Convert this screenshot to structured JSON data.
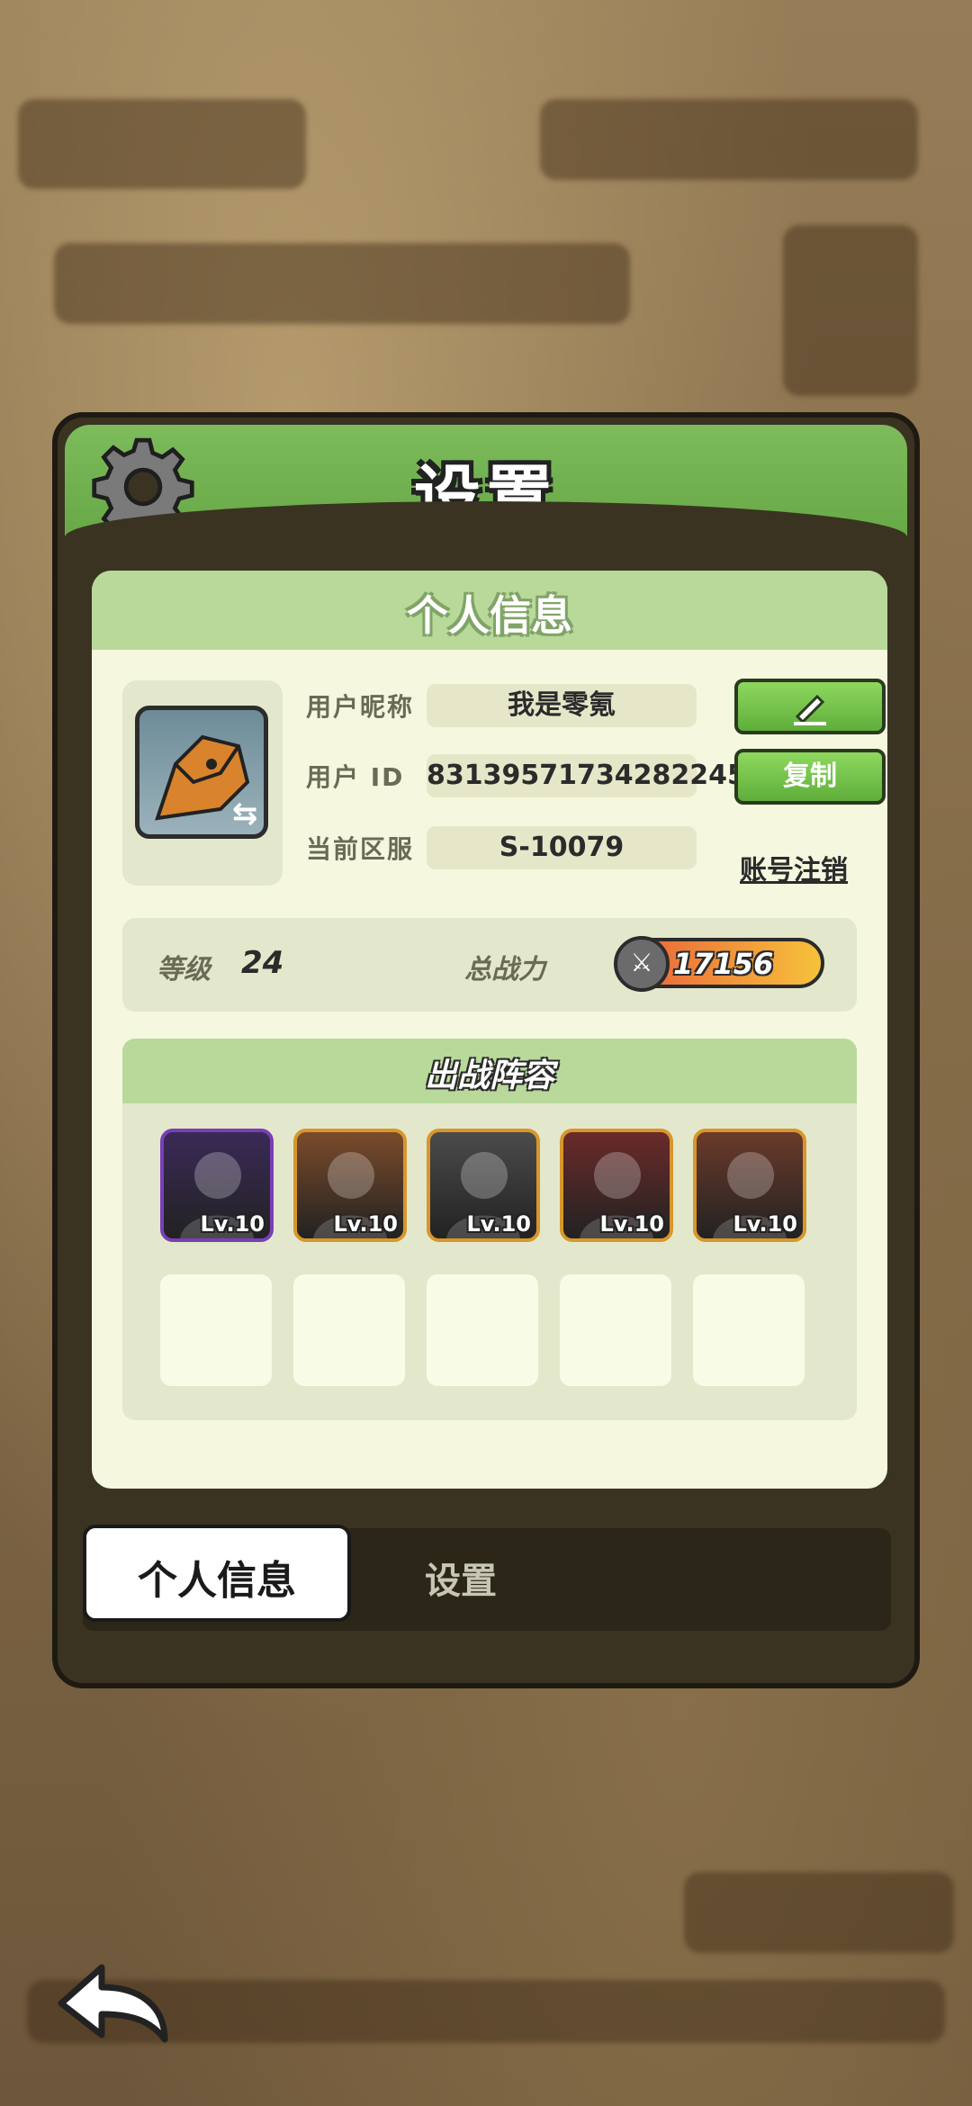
{
  "title": "设置",
  "profile": {
    "section_title": "个人信息",
    "nickname_label": "用户昵称",
    "nickname_value": "我是零氪",
    "id_label": "用户 ID",
    "id_value": "83139571734282245",
    "server_label": "当前区服",
    "server_value": "S-10079",
    "copy_button": "复制",
    "delete_account_link": "账号注销",
    "level_label": "等级",
    "level_value": "24",
    "power_label": "总战力",
    "power_value": "17156"
  },
  "team": {
    "title": "出战阵容",
    "heroes": [
      {
        "level": "Lv.10",
        "frame": "#7a3fb5"
      },
      {
        "level": "Lv.10",
        "frame": "#d8962c"
      },
      {
        "level": "Lv.10",
        "frame": "#d8962c"
      },
      {
        "level": "Lv.10",
        "frame": "#d8962c"
      },
      {
        "level": "Lv.10",
        "frame": "#d8962c"
      }
    ]
  },
  "tabs": [
    "个人信息",
    "设置"
  ],
  "icons": {
    "header": "gear-icon",
    "edit": "edit-pencil-icon",
    "back": "back-arrow-icon"
  }
}
